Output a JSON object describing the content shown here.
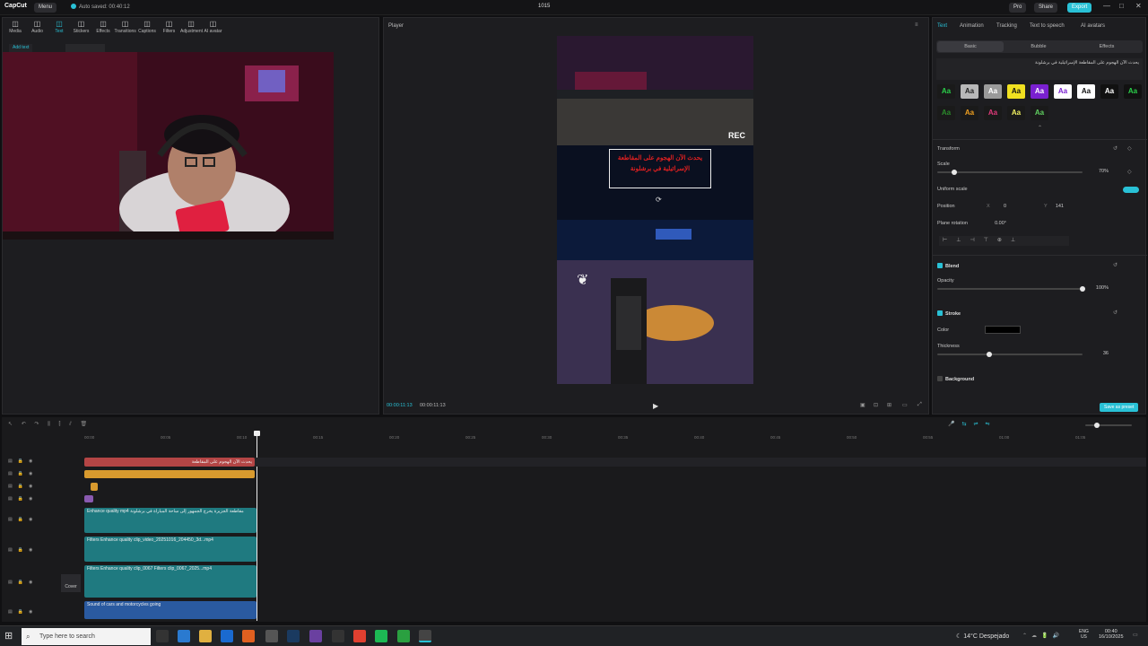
{
  "titlebar": {
    "app_name": "CapCut",
    "menu_label": "Menu",
    "autosave": "Auto saved: 00:40:12",
    "project_name": "1015",
    "pro_label": "Pro",
    "share_label": "Share",
    "export_label": "Export"
  },
  "toolbar": [
    {
      "label": "Media",
      "icon": "media-icon"
    },
    {
      "label": "Audio",
      "icon": "audio-icon"
    },
    {
      "label": "Text",
      "icon": "text-icon"
    },
    {
      "label": "Stickers",
      "icon": "stickers-icon"
    },
    {
      "label": "Effects",
      "icon": "effects-icon"
    },
    {
      "label": "Transitions",
      "icon": "transitions-icon"
    },
    {
      "label": "Captions",
      "icon": "captions-icon"
    },
    {
      "label": "Filters",
      "icon": "filters-icon"
    },
    {
      "label": "Adjustment",
      "icon": "adjustment-icon"
    },
    {
      "label": "AI avatar",
      "icon": "ai-avatar-icon"
    }
  ],
  "left": {
    "add_text": "Add text"
  },
  "player": {
    "title": "Player",
    "current_time": "00:00:11:13",
    "total_time": "00:00:11:13",
    "rec_label": "REC",
    "overlay_text": "يحدث الآن الهجوم على المقاطعة الإسرائيلية في برشلونة"
  },
  "right": {
    "tabs": [
      "Text",
      "Animation",
      "Tracking",
      "Text to speech",
      "AI avatars"
    ],
    "subtabs": [
      "Basic",
      "Bubble",
      "Effects"
    ],
    "text_preview": "يحدث الآن الهجوم على المقاطعة الإسرائيلية في برشلونة",
    "presets_row1": [
      "Aa",
      "Aa",
      "Aa",
      "Aa",
      "Aa",
      "Aa",
      "Aa",
      "Aa",
      "Aa"
    ],
    "presets_row2": [
      "Aa",
      "Aa",
      "Aa",
      "Aa",
      "Aa"
    ],
    "transform_label": "Transform",
    "scale_label": "Scale",
    "scale_value": "70%",
    "scale_fraction": 0.12,
    "uniform_scale_label": "Uniform scale",
    "position_label": "Position",
    "pos_x_label": "X",
    "pos_x": "0",
    "pos_y_label": "Y",
    "pos_y": "141",
    "plane_rotation_label": "Plane rotation",
    "plane_rotation": "0.00°",
    "blend_label": "Blend",
    "opacity_label": "Opacity",
    "opacity_value": "100%",
    "opacity_fraction": 1.0,
    "stroke_label": "Stroke",
    "color_label": "Color",
    "thickness_label": "Thickness",
    "thickness_value": "36",
    "thickness_fraction": 0.36,
    "background_label": "Background",
    "save_preset": "Save as preset"
  },
  "timeline": {
    "ticks": [
      "00:00",
      "00:05",
      "00:10",
      "00:15",
      "00:20",
      "00:25",
      "00:30",
      "00:35",
      "00:40",
      "00:45",
      "00:50",
      "00:55",
      "01:00",
      "01:05"
    ],
    "cover_label": "Cover",
    "text_clip": "يحدث الآن الهجوم على المقاطعة",
    "clip1": "Enhance quality  mp4  مقاطعة الجزيرة يخرج الجمهور إلى ساحة المباراة في برشلونة",
    "clip2": "Filters  Enhance quality  clip_video_20251016_204450_3d...mp4",
    "clip3": "Filters  Enhance quality  clip_0067  Filters  clip_0067_2025...mp4",
    "audio_clip": "Sound of cars and motorcycles going"
  },
  "taskbar": {
    "search_placeholder": "Type here to search",
    "weather": "14°C  Despejado",
    "lang": "ENG",
    "region": "US",
    "time": "00:40",
    "date": "16/10/2025"
  },
  "colors": {
    "accent": "#29c1d6",
    "panel": "#1d1d20",
    "text_clip": "#b44545",
    "sticker_clip": "#d89a2e",
    "video_clip": "#1f7a80",
    "audio_clip": "#2a5aa0"
  }
}
